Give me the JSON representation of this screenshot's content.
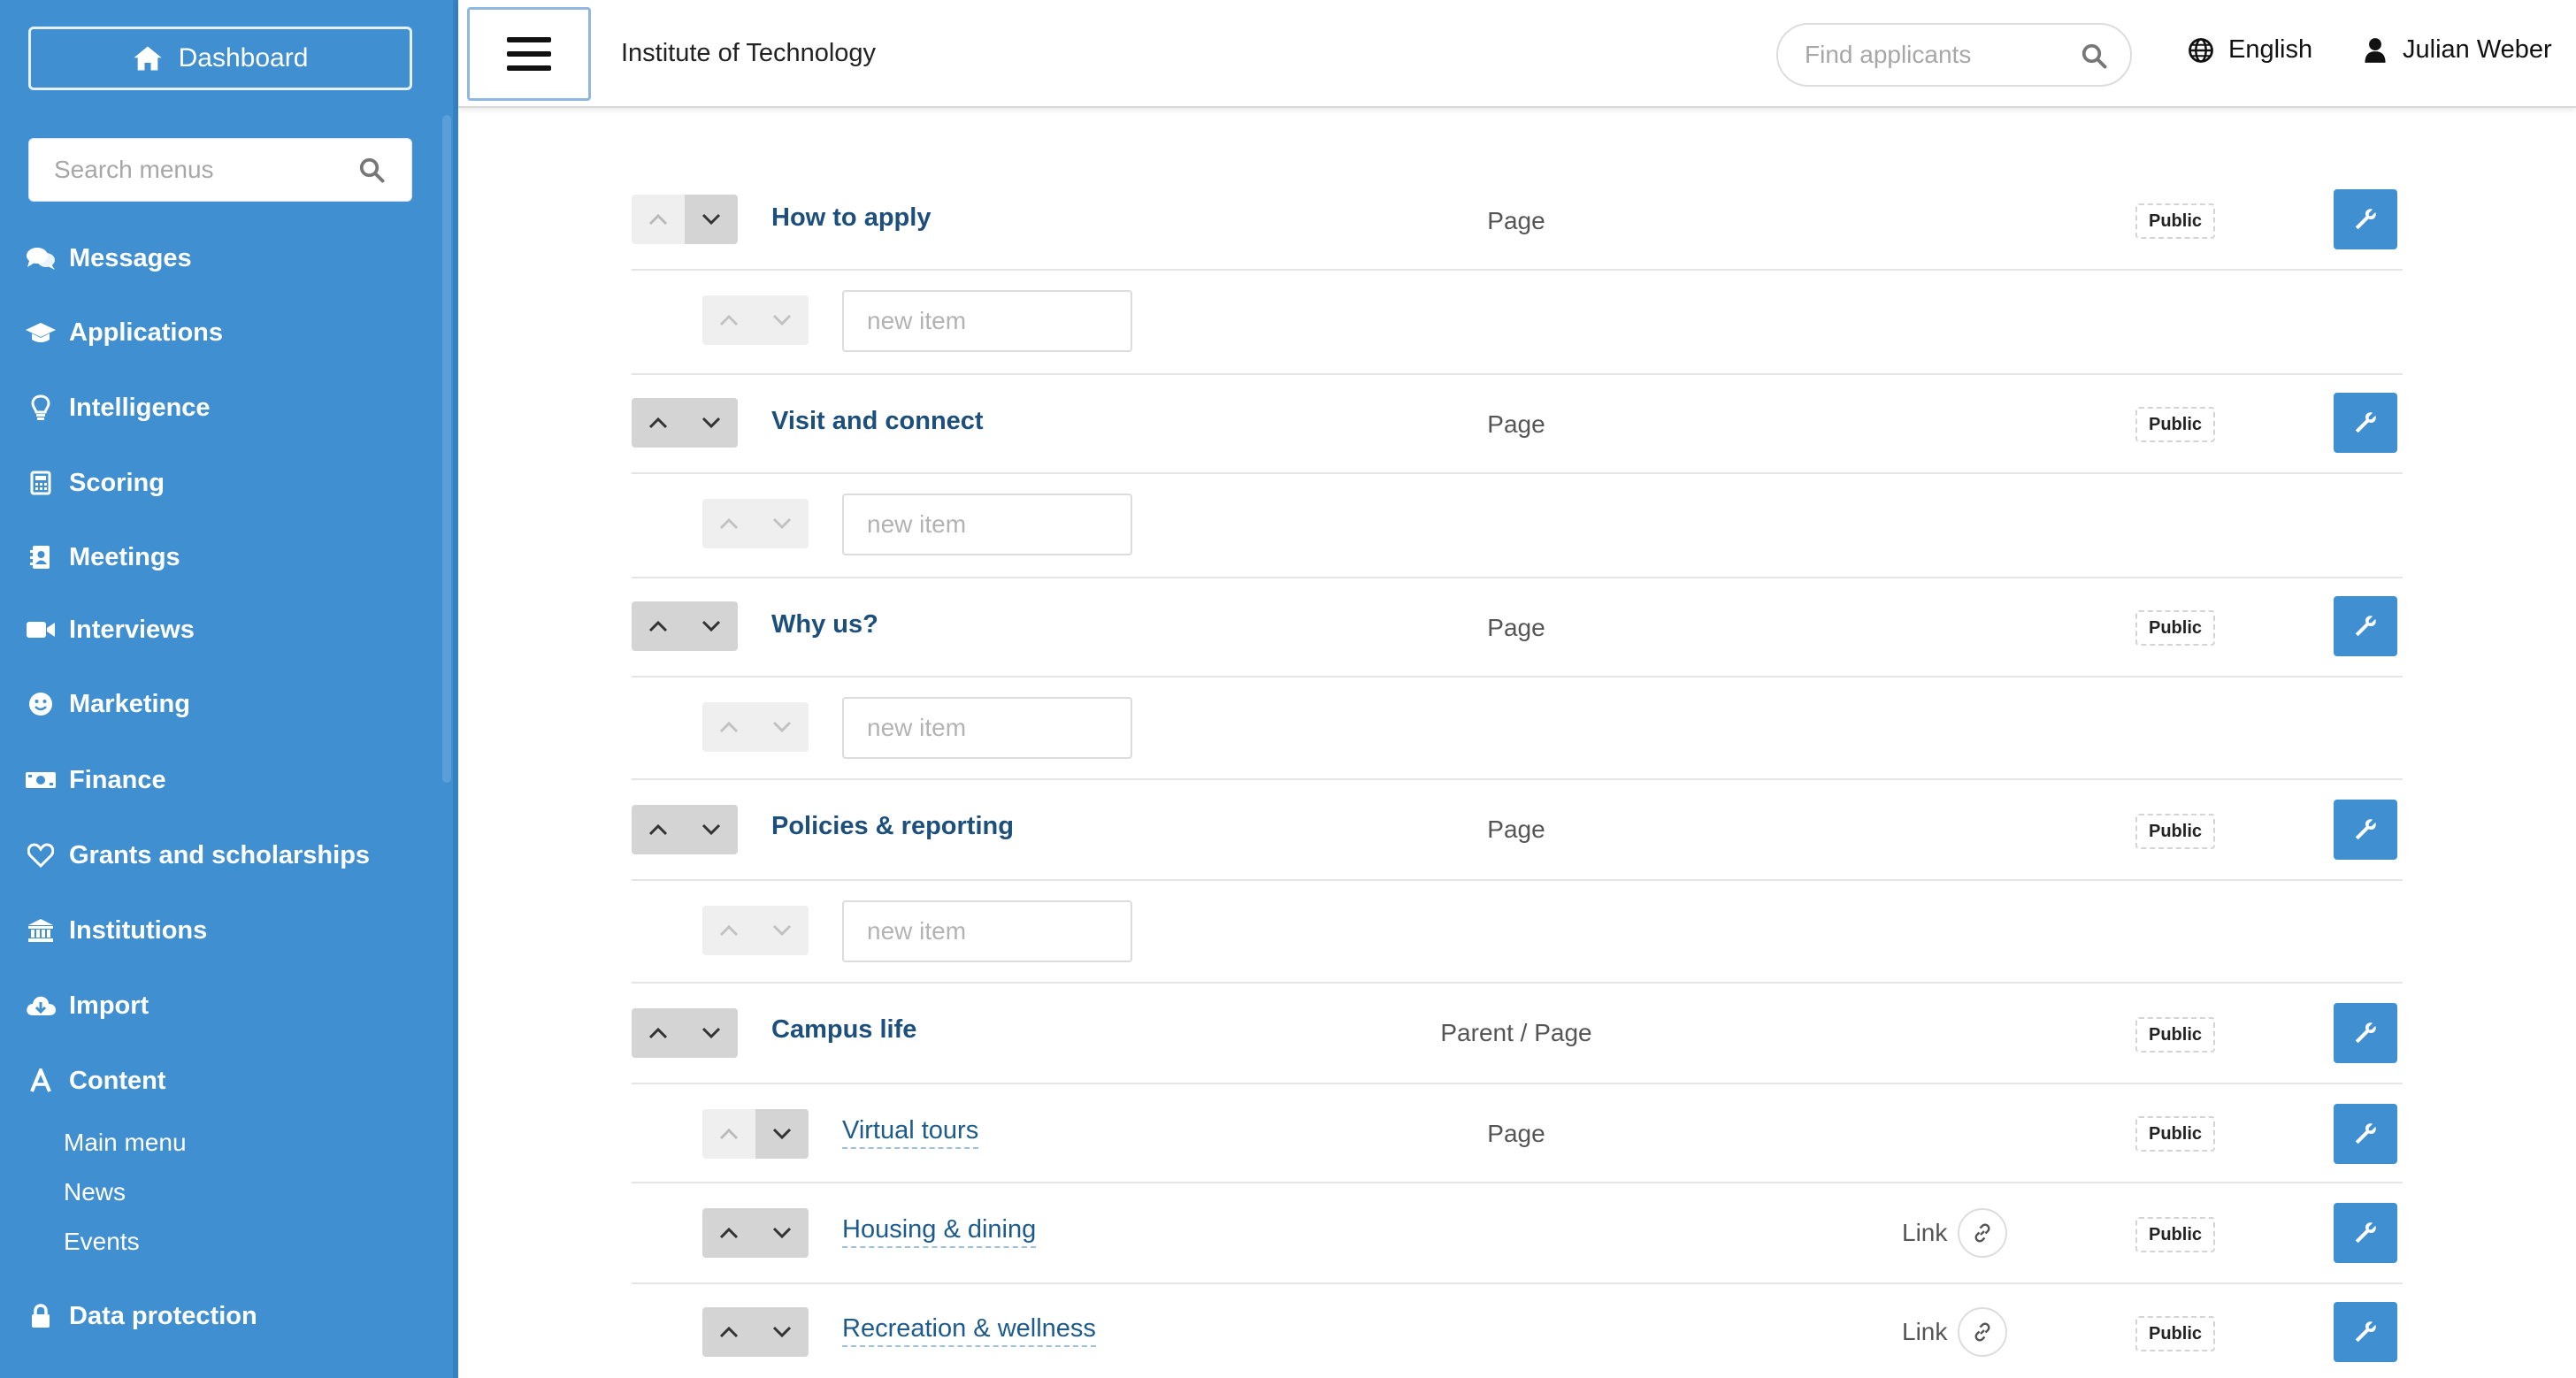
{
  "sidebar": {
    "dashboard_label": "Dashboard",
    "search_placeholder": "Search menus",
    "nav": [
      {
        "label": "Messages",
        "icon": "comments-icon"
      },
      {
        "label": "Applications",
        "icon": "graduation-cap-icon"
      },
      {
        "label": "Intelligence",
        "icon": "lightbulb-icon"
      },
      {
        "label": "Scoring",
        "icon": "calculator-icon"
      },
      {
        "label": "Meetings",
        "icon": "address-book-icon"
      },
      {
        "label": "Interviews",
        "icon": "video-camera-icon"
      },
      {
        "label": "Marketing",
        "icon": "smile-icon"
      },
      {
        "label": "Finance",
        "icon": "money-bill-icon"
      },
      {
        "label": "Grants and scholarships",
        "icon": "heart-icon"
      },
      {
        "label": "Institutions",
        "icon": "university-icon"
      },
      {
        "label": "Import",
        "icon": "cloud-download-icon"
      },
      {
        "label": "Content",
        "icon": "font-icon"
      },
      {
        "label": "Data protection",
        "icon": "lock-icon"
      }
    ],
    "content_sub": [
      {
        "label": "Main menu"
      },
      {
        "label": "News"
      },
      {
        "label": "Events"
      }
    ]
  },
  "header": {
    "org_title": "Institute of Technology",
    "search_placeholder": "Find applicants",
    "language": "English",
    "user_name": "Julian Weber"
  },
  "menu": {
    "new_item_placeholder": "new item",
    "rows": [
      {
        "title": "How to apply",
        "type": "Page",
        "badge": "Public"
      },
      {
        "title": "Visit and connect",
        "type": "Page",
        "badge": "Public"
      },
      {
        "title": "Why us?",
        "type": "Page",
        "badge": "Public"
      },
      {
        "title": "Policies & reporting",
        "type": "Page",
        "badge": "Public"
      },
      {
        "title": "Campus life",
        "type": "Parent / Page",
        "badge": "Public"
      },
      {
        "title": "Virtual tours",
        "type": "Page",
        "badge": "Public"
      },
      {
        "title": "Housing & dining",
        "type": "Link",
        "badge": "Public"
      },
      {
        "title": "Recreation & wellness",
        "type": "Link",
        "badge": "Public"
      }
    ]
  },
  "colors": {
    "sidebar_bg": "#3f8fd1",
    "accent": "#3f8fd1",
    "title_text": "#1d4f7c"
  }
}
